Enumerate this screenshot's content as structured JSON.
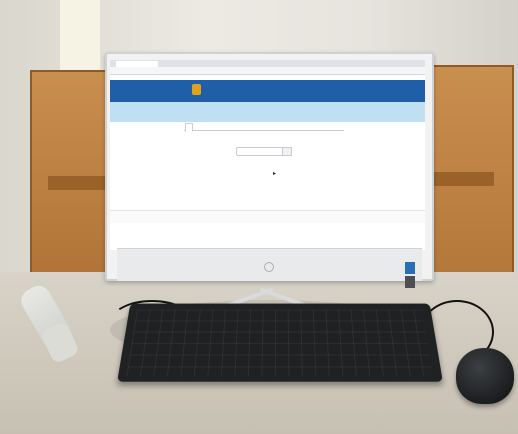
{
  "photo": {
    "subject": "desktop-computer-on-desk",
    "screen": {
      "browser": {
        "tab_label": "",
        "address": "",
        "bookmarks": ""
      },
      "site": {
        "title": "",
        "subtitle": "",
        "login_text": ""
      },
      "band": {
        "title": "",
        "subtitle": "",
        "note": ""
      },
      "nav_tabs": [
        {
          "label": ""
        },
        {
          "label": ""
        },
        {
          "label": ""
        }
      ],
      "search": {
        "label": "",
        "placeholder": ""
      },
      "footer": {
        "left_text": "",
        "right_text": ""
      }
    },
    "colors": {
      "site_header": "#1e5fa8",
      "band": "#bfe0f2",
      "desk": "#d8d3c8",
      "cubicle_wood": "#c98f4f"
    }
  }
}
